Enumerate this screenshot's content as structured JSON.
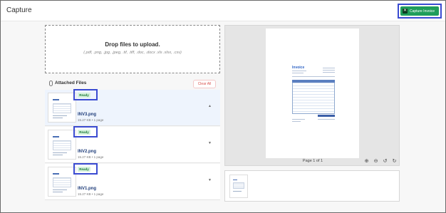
{
  "header": {
    "title": "Capture",
    "capture_button": {
      "label": "Capture Invoice",
      "icon": "capture-icon"
    }
  },
  "upload": {
    "title": "Drop files to upload.",
    "formats": "(.pdf, .png, .jpg, .jpeg, .tif, .tiff, .doc, .docx .xls .xlsx, .csv)"
  },
  "attached": {
    "title": "Attached Files",
    "clear_label": "Clear All",
    "files": [
      {
        "status": "Ready",
        "name": "INV3.png",
        "meta": "15.27 KB • 1 page"
      },
      {
        "status": "Ready",
        "name": "INV2.png",
        "meta": "15.27 KB • 1 page"
      },
      {
        "status": "Ready",
        "name": "INV1.png",
        "meta": "15.27 KB • 1 page"
      }
    ]
  },
  "preview": {
    "document_title": "Invoice",
    "page_label": "Page 1 of 1",
    "tools": [
      "zoom-in-icon",
      "zoom-out-icon",
      "rotate-left-icon",
      "rotate-right-icon"
    ]
  },
  "colors": {
    "accent": "#1f9d5b",
    "highlight": "#3a4bd1",
    "ready": "#d6f2dd",
    "selected": "#eef4fd"
  }
}
